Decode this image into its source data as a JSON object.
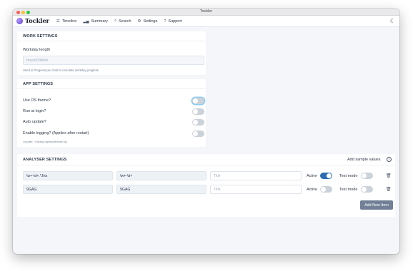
{
  "window": {
    "title": "Tockler"
  },
  "nav": {
    "logo": "Tockler",
    "items": [
      {
        "label": "Timeline",
        "icon": "list-icon"
      },
      {
        "label": "Summary",
        "icon": "chart-icon"
      },
      {
        "label": "Search",
        "icon": "search-icon"
      },
      {
        "label": "Settings",
        "icon": "gear-icon"
      },
      {
        "label": "Support",
        "icon": "help-icon"
      }
    ],
    "theme_icon": "moon-icon"
  },
  "work_settings": {
    "title": "WORK SETTINGS",
    "workday_label": "Workday length",
    "workday_placeholder": "hoursToWork",
    "workday_hint": "Used in Progress pie chart to calculate workday progress"
  },
  "app_settings": {
    "title": "APP SETTINGS",
    "rows": [
      {
        "label": "Use OS theme?",
        "on": false
      },
      {
        "label": "Run at login?",
        "on": false
      },
      {
        "label": "Auto update?",
        "on": false
      },
      {
        "label": "Enable logging? (Applies after restart)",
        "on": false
      }
    ],
    "log_path": "Log path: ~/Library/Logs/tockler/main.log"
  },
  "analyser_settings": {
    "title": "ANALYSER SETTINGS",
    "add_sample_label": "Add sample values",
    "active_label": "Active",
    "test_mode_label": "Test mode",
    "title_placeholder": "Title",
    "rows": [
      {
        "find_regex": "\\w+-\\d+.*Jira",
        "value_regex": "\\w+-\\d+",
        "title": "",
        "active": true,
        "test_mode": false
      },
      {
        "find_regex": "9GAG",
        "value_regex": "9GAG",
        "title": "",
        "active": false,
        "test_mode": false
      }
    ],
    "add_new_label": "Add New Item"
  }
}
